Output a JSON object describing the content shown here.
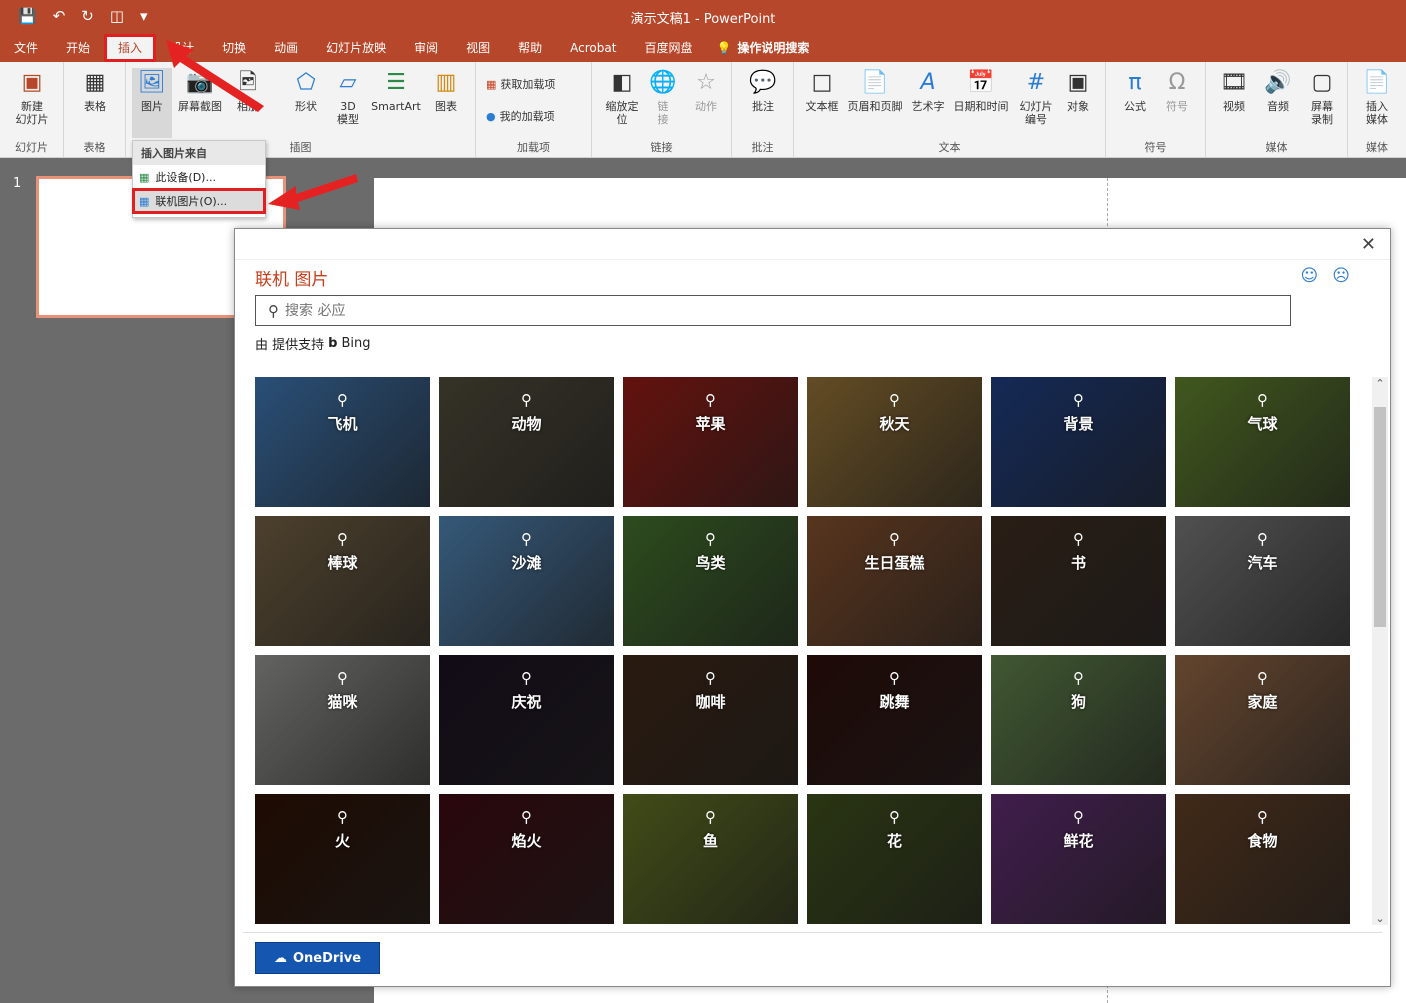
{
  "titlebar": {
    "title": "演示文稿1  -  PowerPoint",
    "qat_icons": [
      "save-icon",
      "undo-icon",
      "redo-icon",
      "present-icon",
      "customize-icon"
    ]
  },
  "menu": {
    "tabs": [
      "文件",
      "开始",
      "插入",
      "设计",
      "切换",
      "动画",
      "幻灯片放映",
      "审阅",
      "视图",
      "帮助",
      "Acrobat",
      "百度网盘"
    ],
    "active_tab": "插入",
    "tell_me": "操作说明搜索"
  },
  "ribbon": {
    "groups": {
      "slides": {
        "label": "幻灯片",
        "new_slide": "新建\n幻灯片"
      },
      "tables": {
        "label": "表格",
        "table": "表格"
      },
      "images": {
        "label": "插图",
        "picture": "图片",
        "screenshot": "屏幕截图",
        "album": "相册",
        "shapes": "形状",
        "model3d": "3D\n模型",
        "smartart": "SmartArt",
        "chart": "图表"
      },
      "addins": {
        "label": "加载项",
        "get_addins": "获取加载项",
        "my_addins": "我的加载项"
      },
      "links": {
        "label": "链接",
        "zoom": "缩放定\n位",
        "link": "链\n接",
        "action": "动作"
      },
      "comments": {
        "label": "批注",
        "comment": "批注"
      },
      "text": {
        "label": "文本",
        "textbox": "文本框",
        "header_footer": "页眉和页脚",
        "wordart": "艺术字",
        "datetime": "日期和时间",
        "slide_number": "幻灯片\n编号",
        "object": "对象"
      },
      "symbols": {
        "label": "符号",
        "equation": "公式",
        "symbol": "符号"
      },
      "media": {
        "label": "媒体",
        "video": "视频",
        "audio": "音频",
        "screen_record": "屏幕\n录制",
        "insert_media": "插入\n媒体",
        "label2": "媒体"
      }
    }
  },
  "picture_menu": {
    "header": "插入图片来自",
    "items": [
      "此设备(D)...",
      "联机图片(O)..."
    ]
  },
  "slides_panel": {
    "slide_number": "1"
  },
  "dialog": {
    "title": "联机 图片",
    "search_placeholder": "搜索 必应",
    "powered_by": "由 提供支持",
    "bing": "Bing",
    "onedrive": "OneDrive",
    "tiles": [
      {
        "label": "飞机",
        "color": "#3a6ea5"
      },
      {
        "label": "动物",
        "color": "#4a4636"
      },
      {
        "label": "苹果",
        "color": "#8b1a14"
      },
      {
        "label": "秋天",
        "color": "#8a6a32"
      },
      {
        "label": "背景",
        "color": "#1d3a78"
      },
      {
        "label": "气球",
        "color": "#5a7a2a"
      },
      {
        "label": "棒球",
        "color": "#6b5a3e"
      },
      {
        "label": "沙滩",
        "color": "#4a7ba8"
      },
      {
        "label": "鸟类",
        "color": "#3e6a2a"
      },
      {
        "label": "生日蛋糕",
        "color": "#7a4a2a"
      },
      {
        "label": "书",
        "color": "#3a2a1e"
      },
      {
        "label": "汽车",
        "color": "#707070"
      },
      {
        "label": "猫咪",
        "color": "#8a8a86"
      },
      {
        "label": "庆祝",
        "color": "#1a1020"
      },
      {
        "label": "咖啡",
        "color": "#3a2416"
      },
      {
        "label": "跳舞",
        "color": "#2a0e0a"
      },
      {
        "label": "狗",
        "color": "#5a7a46"
      },
      {
        "label": "家庭",
        "color": "#8a6040"
      },
      {
        "label": "火",
        "color": "#2a1004"
      },
      {
        "label": "焰火",
        "color": "#3a0a10"
      },
      {
        "label": "鱼",
        "color": "#5a6a20"
      },
      {
        "label": "花",
        "color": "#3a4a1a"
      },
      {
        "label": "鲜花",
        "color": "#5a2a6a"
      },
      {
        "label": "食物",
        "color": "#5a3a22"
      }
    ]
  }
}
